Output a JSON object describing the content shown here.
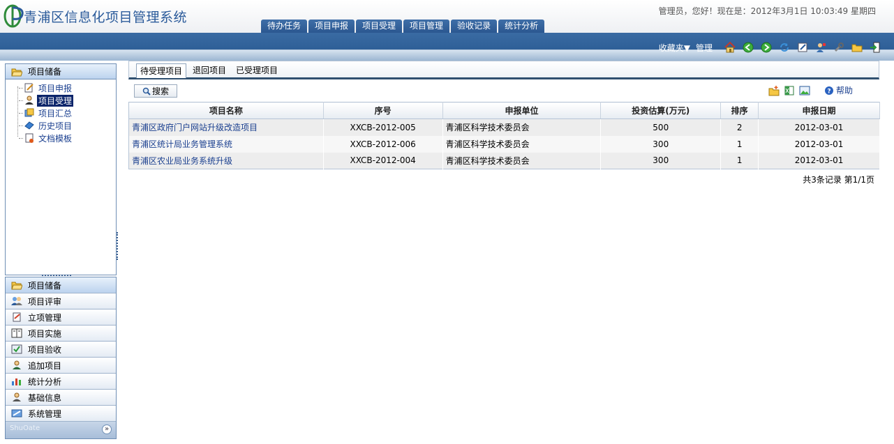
{
  "app": {
    "title": "青浦区信息化项目管理系统"
  },
  "header": {
    "greeting": "管理员，您好！现在是：2012年3月1日  10:03:49 星期四"
  },
  "top_tabs": [
    "待办任务",
    "项目申报",
    "项目受理",
    "项目管理",
    "验收记录",
    "统计分析"
  ],
  "toolbar": {
    "favorites": "收藏夹▼",
    "manage": "管理"
  },
  "left_panel": {
    "title": "项目储备",
    "tree": [
      {
        "label": "项目申报",
        "icon": "form-edit-icon"
      },
      {
        "label": "项目受理",
        "icon": "user-icon",
        "selected": true
      },
      {
        "label": "项目汇总",
        "icon": "summary-icon"
      },
      {
        "label": "历史项目",
        "icon": "history-icon"
      },
      {
        "label": "文档模板",
        "icon": "document-icon"
      }
    ]
  },
  "accordion": [
    {
      "label": "项目储备",
      "icon": "folder-icon",
      "active": true
    },
    {
      "label": "项目评审",
      "icon": "users-icon"
    },
    {
      "label": "立项管理",
      "icon": "clipboard-icon"
    },
    {
      "label": "项目实施",
      "icon": "book-icon"
    },
    {
      "label": "项目验收",
      "icon": "accept-icon"
    },
    {
      "label": "追加项目",
      "icon": "user-add-icon"
    },
    {
      "label": "统计分析",
      "icon": "chart-icon"
    },
    {
      "label": "基础信息",
      "icon": "info-icon"
    },
    {
      "label": "系统管理",
      "icon": "settings-icon"
    }
  ],
  "accordion_footer": {
    "brand": "ShuOate"
  },
  "main": {
    "tabs": [
      "待受理项目",
      "退回项目",
      "已受理项目"
    ],
    "search_label": "搜索",
    "help_label": "帮助",
    "columns": [
      "项目名称",
      "序号",
      "申报单位",
      "投资估算(万元)",
      "排序",
      "申报日期"
    ],
    "rows": [
      [
        "青浦区政府门户网站升级改造项目",
        "XXCB-2012-005",
        "青浦区科学技术委员会",
        "500",
        "2",
        "2012-03-01"
      ],
      [
        "青浦区统计局业务管理系统",
        "XXCB-2012-006",
        "青浦区科学技术委员会",
        "300",
        "1",
        "2012-03-01"
      ],
      [
        "青浦区农业局业务系统升级",
        "XXCB-2012-004",
        "青浦区科学技术委员会",
        "300",
        "1",
        "2012-03-01"
      ]
    ],
    "pager": "共3条记录 第1/1页"
  },
  "colors": {
    "accent": "#2e5f97",
    "link": "#1a3f8f",
    "selected": "#0a246a"
  }
}
